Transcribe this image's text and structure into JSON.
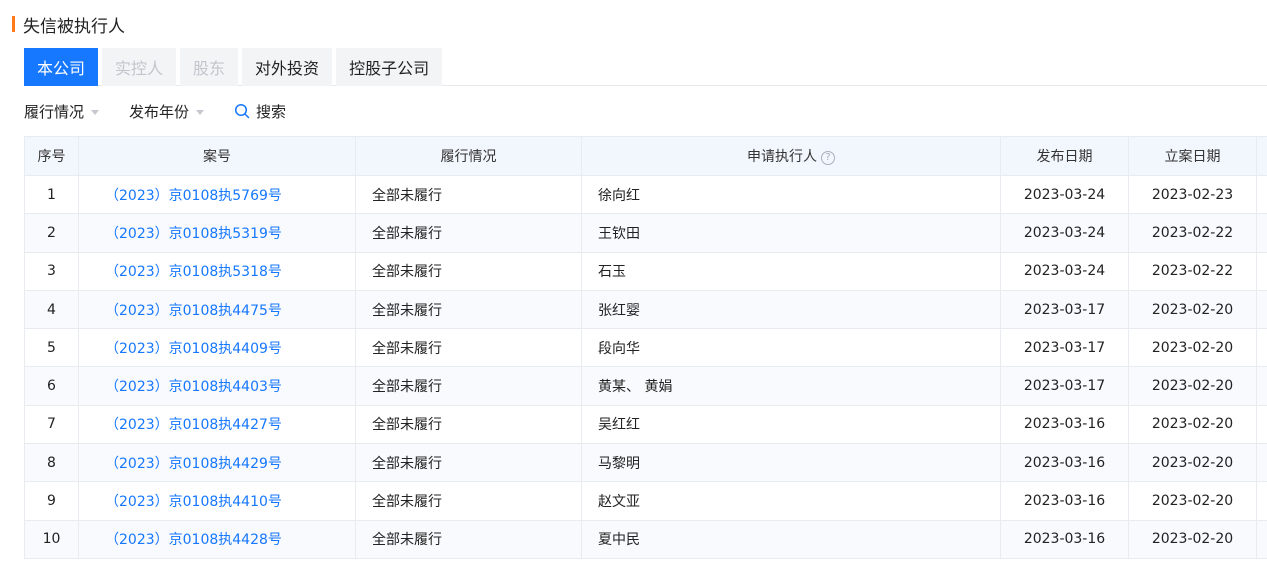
{
  "section": {
    "title": "失信被执行人"
  },
  "tabs": [
    {
      "label": "本公司",
      "state": "active"
    },
    {
      "label": "实控人",
      "state": "disabled"
    },
    {
      "label": "股东",
      "state": "disabled"
    },
    {
      "label": "对外投资",
      "state": "normal"
    },
    {
      "label": "控股子公司",
      "state": "normal"
    }
  ],
  "filters": {
    "performance": "履行情况",
    "publish_year": "发布年份",
    "search": "搜索",
    "search_icon": "search-icon",
    "caret_icon": "caret-down-icon"
  },
  "table": {
    "headers": {
      "index": "序号",
      "case_no": "案号",
      "status": "履行情况",
      "applicant": "申请执行人",
      "applicant_help": "?",
      "publish_date": "发布日期",
      "filing_date": "立案日期"
    },
    "rows": [
      {
        "index": "1",
        "case_no": "（2023）京0108执5769号",
        "status": "全部未履行",
        "applicant": "徐向红",
        "publish_date": "2023-03-24",
        "filing_date": "2023-02-23"
      },
      {
        "index": "2",
        "case_no": "（2023）京0108执5319号",
        "status": "全部未履行",
        "applicant": "王钦田",
        "publish_date": "2023-03-24",
        "filing_date": "2023-02-22"
      },
      {
        "index": "3",
        "case_no": "（2023）京0108执5318号",
        "status": "全部未履行",
        "applicant": "石玉",
        "publish_date": "2023-03-24",
        "filing_date": "2023-02-22"
      },
      {
        "index": "4",
        "case_no": "（2023）京0108执4475号",
        "status": "全部未履行",
        "applicant": "张红婴",
        "publish_date": "2023-03-17",
        "filing_date": "2023-02-20"
      },
      {
        "index": "5",
        "case_no": "（2023）京0108执4409号",
        "status": "全部未履行",
        "applicant": "段向华",
        "publish_date": "2023-03-17",
        "filing_date": "2023-02-20"
      },
      {
        "index": "6",
        "case_no": "（2023）京0108执4403号",
        "status": "全部未履行",
        "applicant": "黄某、 黄娟",
        "publish_date": "2023-03-17",
        "filing_date": "2023-02-20"
      },
      {
        "index": "7",
        "case_no": "（2023）京0108执4427号",
        "status": "全部未履行",
        "applicant": "吴红红",
        "publish_date": "2023-03-16",
        "filing_date": "2023-02-20"
      },
      {
        "index": "8",
        "case_no": "（2023）京0108执4429号",
        "status": "全部未履行",
        "applicant": "马黎明",
        "publish_date": "2023-03-16",
        "filing_date": "2023-02-20"
      },
      {
        "index": "9",
        "case_no": "（2023）京0108执4410号",
        "status": "全部未履行",
        "applicant": "赵文亚",
        "publish_date": "2023-03-16",
        "filing_date": "2023-02-20"
      },
      {
        "index": "10",
        "case_no": "（2023）京0108执4428号",
        "status": "全部未履行",
        "applicant": "夏中民",
        "publish_date": "2023-03-16",
        "filing_date": "2023-02-20"
      }
    ]
  },
  "colors": {
    "accent": "#1677ff",
    "title_bar": "#ff7a1a",
    "header_bg": "#f2f6fd"
  }
}
